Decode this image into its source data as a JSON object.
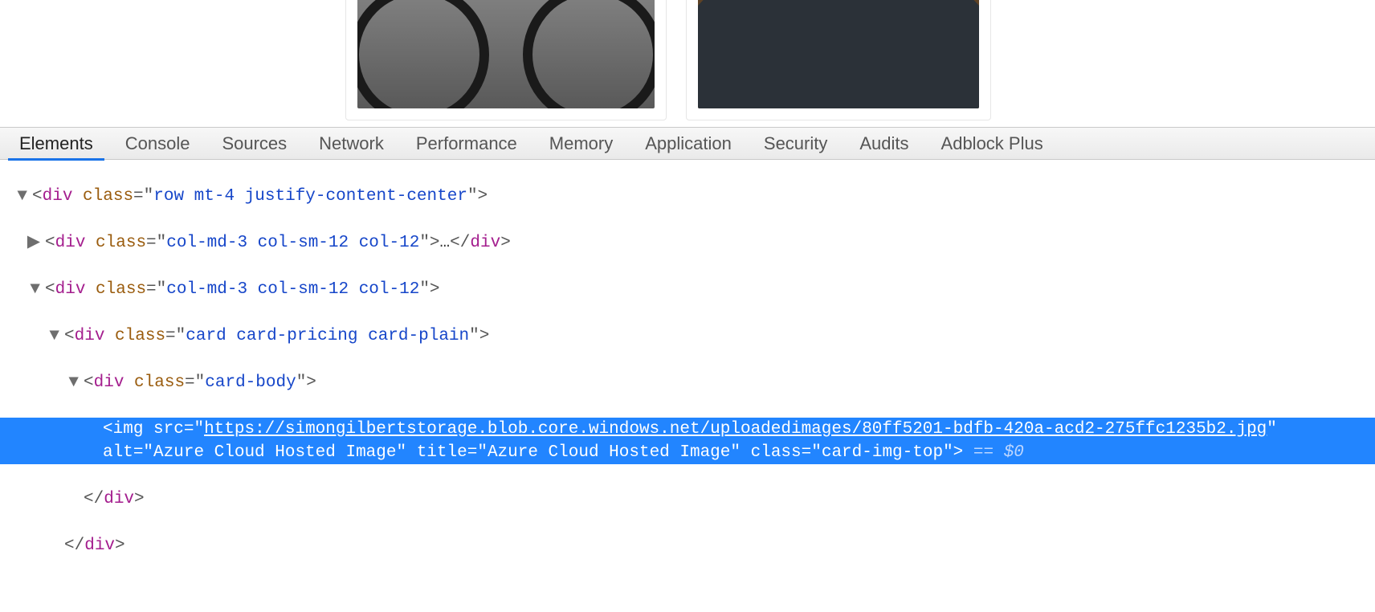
{
  "devtools": {
    "tabs": [
      "Elements",
      "Console",
      "Sources",
      "Network",
      "Performance",
      "Memory",
      "Application",
      "Security",
      "Audits",
      "Adblock Plus"
    ],
    "active_tab": 0
  },
  "tree": {
    "row_div_class": "row mt-4 justify-content-center",
    "col_class": "col-md-3 col-sm-12 col-12",
    "card_class": "card card-pricing card-plain",
    "card_body_class": "card-body",
    "img": {
      "src": "https://simongilbertstorage.blob.core.windows.net/uploadedimages/80ff5201-bdfb-420a-acd2-275ffc1235b2.jpg",
      "alt": "Azure Cloud Hosted Image",
      "title": "Azure Cloud Hosted Image",
      "cls": "card-img-top"
    },
    "sel_suffix": " == $0",
    "collapsed_ellipsis": "…"
  }
}
